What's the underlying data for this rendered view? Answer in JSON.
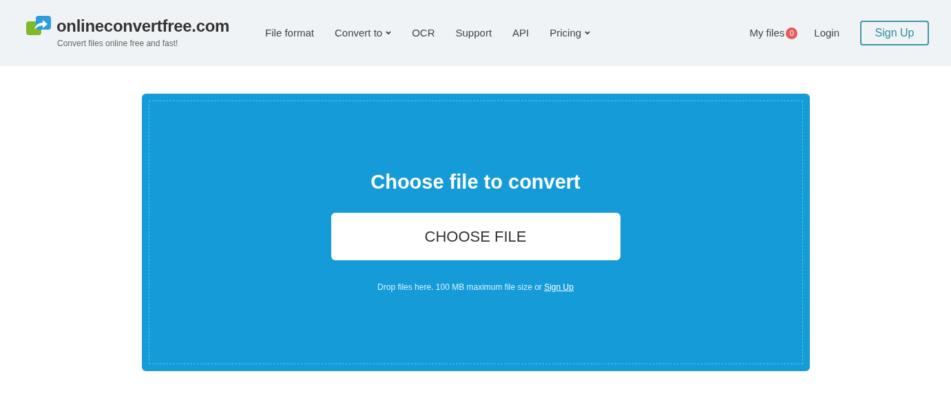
{
  "header": {
    "logo": {
      "name": "onlineconvertfree.com",
      "tagline": "Convert files online free and fast!"
    },
    "nav": [
      {
        "label": "File format",
        "dropdown": false
      },
      {
        "label": "Convert to",
        "dropdown": true
      },
      {
        "label": "OCR",
        "dropdown": false
      },
      {
        "label": "Support",
        "dropdown": false
      },
      {
        "label": "API",
        "dropdown": false
      },
      {
        "label": "Pricing",
        "dropdown": true
      }
    ],
    "my_files": {
      "label": "My files",
      "count": "0"
    },
    "login": "Login",
    "sign_up": "Sign Up"
  },
  "upload": {
    "title": "Choose file to convert",
    "button": "CHOOSE FILE",
    "note": "Drop files here. 100 MB maximum file size or",
    "note_link": "Sign Up"
  }
}
